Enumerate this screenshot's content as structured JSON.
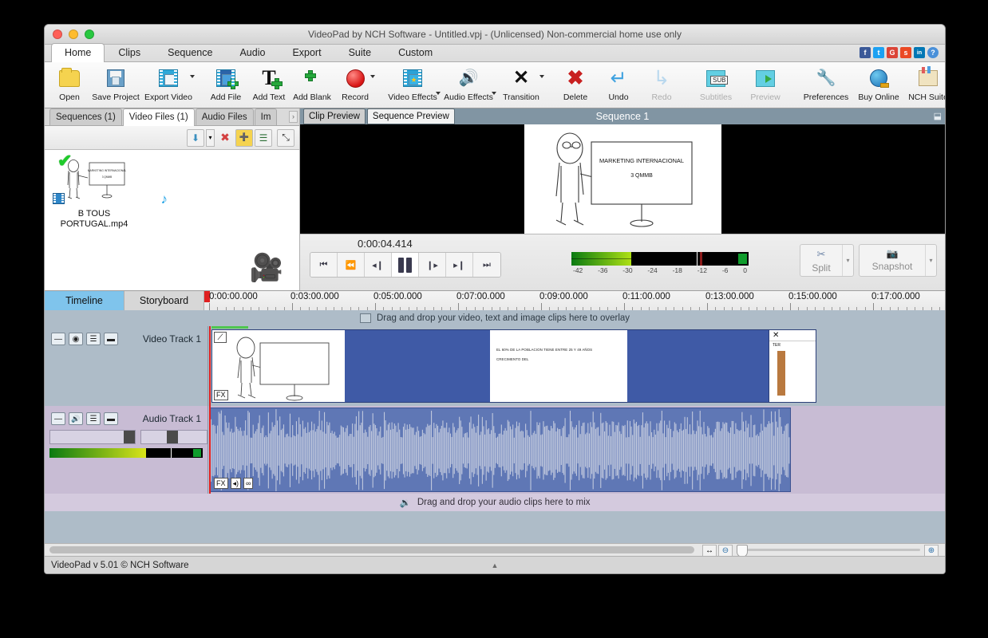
{
  "window": {
    "title": "VideoPad by NCH Software - Untitled.vpj - (Unlicensed) Non-commercial home use only"
  },
  "ribbon": {
    "tabs": [
      {
        "label": "Home",
        "active": true
      },
      {
        "label": "Clips",
        "active": false
      },
      {
        "label": "Sequence",
        "active": false
      },
      {
        "label": "Audio",
        "active": false
      },
      {
        "label": "Export",
        "active": false
      },
      {
        "label": "Suite",
        "active": false
      },
      {
        "label": "Custom",
        "active": false
      }
    ],
    "social": [
      {
        "name": "facebook-icon",
        "glyph": "f",
        "color": "#3b5998"
      },
      {
        "name": "twitter-icon",
        "glyph": "t",
        "color": "#1da1f2"
      },
      {
        "name": "google-plus-icon",
        "glyph": "G",
        "color": "#db4437"
      },
      {
        "name": "stumbleupon-icon",
        "glyph": "s",
        "color": "#eb4924"
      },
      {
        "name": "linkedin-icon",
        "glyph": "in",
        "color": "#0077b5"
      },
      {
        "name": "help-icon",
        "glyph": "?",
        "color": "#4a90d9"
      }
    ],
    "buttons": [
      {
        "label": "Open",
        "icon": "open-folder-icon",
        "dim": false
      },
      {
        "label": "Save Project",
        "icon": "save-project-icon",
        "dim": false
      },
      {
        "label": "Export Video",
        "icon": "export-video-icon",
        "dim": false
      },
      {
        "label": "Add File",
        "icon": "add-file-icon",
        "dim": false
      },
      {
        "label": "Add Text",
        "icon": "add-text-icon",
        "dim": false
      },
      {
        "label": "Add Blank",
        "icon": "add-blank-icon",
        "dim": false
      },
      {
        "label": "Record",
        "icon": "record-icon",
        "dim": false
      },
      {
        "label": "Video Effects",
        "icon": "video-effects-icon",
        "dim": false
      },
      {
        "label": "Audio Effects",
        "icon": "audio-effects-icon",
        "dim": false
      },
      {
        "label": "Transition",
        "icon": "transition-icon",
        "dim": false
      },
      {
        "label": "Delete",
        "icon": "delete-icon",
        "dim": false
      },
      {
        "label": "Undo",
        "icon": "undo-icon",
        "dim": false
      },
      {
        "label": "Redo",
        "icon": "redo-icon",
        "dim": true
      },
      {
        "label": "Subtitles",
        "icon": "subtitles-icon",
        "dim": true
      },
      {
        "label": "Preview",
        "icon": "preview-icon",
        "dim": true
      },
      {
        "label": "Preferences",
        "icon": "preferences-icon",
        "dim": false
      },
      {
        "label": "Buy Online",
        "icon": "buy-online-icon",
        "dim": false
      },
      {
        "label": "NCH Suite",
        "icon": "nch-suite-icon",
        "dim": false
      }
    ]
  },
  "bin": {
    "tabs": [
      {
        "label": "Sequences (1)",
        "active": false
      },
      {
        "label": "Video Files (1)",
        "active": true
      },
      {
        "label": "Audio Files",
        "active": false
      },
      {
        "label": "Im",
        "active": false
      }
    ],
    "more_label": "›",
    "tools": [
      {
        "name": "add-media-button",
        "glyph": "⬇"
      },
      {
        "name": "add-media-dropdown",
        "glyph": "▾"
      },
      {
        "name": "remove-media-button",
        "glyph": "✖"
      },
      {
        "name": "new-folder-button",
        "glyph": "➕"
      },
      {
        "name": "list-view-button",
        "glyph": "☰"
      },
      {
        "name": "detach-panel-button",
        "glyph": "⤡"
      }
    ],
    "item": {
      "filename": "B TOUS\nPORTUGAL.mp4",
      "filename_line1": "B TOUS",
      "filename_line2": "PORTUGAL.mp4",
      "selected_check": "✔"
    }
  },
  "preview": {
    "tabs": [
      {
        "label": "Clip Preview",
        "active": false
      },
      {
        "label": "Sequence Preview",
        "active": true
      }
    ],
    "title": "Sequence 1",
    "frame_text_line1": "MARKETING INTERNACIONAL",
    "frame_text_line2": "3 QMMB",
    "timecode": "0:00:04.414",
    "transport": [
      {
        "name": "jump-start-button",
        "glyph": "⏮"
      },
      {
        "name": "prev-frame-button",
        "glyph": "⏪"
      },
      {
        "name": "step-back-button",
        "glyph": "◂❙"
      },
      {
        "name": "pause-button",
        "glyph": "❙❙"
      },
      {
        "name": "step-forward-button",
        "glyph": "❙▸"
      },
      {
        "name": "next-frame-button",
        "glyph": "▸❙"
      },
      {
        "name": "jump-end-button",
        "glyph": "⏭"
      }
    ],
    "meter_scale": [
      "-42",
      "-36",
      "-30",
      "-24",
      "-18",
      "-12",
      "-6",
      "0"
    ],
    "split_label": "Split",
    "snapshot_label": "Snapshot"
  },
  "timeline": {
    "view_tabs": [
      {
        "label": "Timeline",
        "active": true
      },
      {
        "label": "Storyboard",
        "active": false
      }
    ],
    "ruler_labels": [
      "0:00:00.000",
      "0:03:00.000",
      "0:05:00.000",
      "0:07:00.000",
      "0:09:00.000",
      "0:11:00.000",
      "0:13:00.000",
      "0:15:00.000",
      "0:17:00.000"
    ],
    "overlay_hint": "Drag and drop your video, text and image clips here to overlay",
    "audio_hint": "Drag and drop your audio clips here to mix",
    "video_track": {
      "name": "Video Track 1",
      "controls": [
        {
          "name": "collapse-track-button",
          "glyph": "—"
        },
        {
          "name": "visibility-eye-icon",
          "glyph": "◉"
        },
        {
          "name": "track-group-icon",
          "glyph": "☰"
        },
        {
          "name": "lock-track-icon",
          "glyph": "▬"
        }
      ],
      "clip_text_line1": "EL 60% DE LA POBLACION TIENE ENTRE 25 Y 49 AÑOS",
      "clip_text_line2": "CRECIMENTO DEL",
      "fx_label": "FX",
      "end_clip_label": "TER"
    },
    "audio_track": {
      "name": "Audio Track 1",
      "controls": [
        {
          "name": "collapse-track-button",
          "glyph": "—"
        },
        {
          "name": "mute-speaker-icon",
          "glyph": "🔊"
        },
        {
          "name": "track-group-icon",
          "glyph": "☰"
        },
        {
          "name": "lock-track-icon",
          "glyph": "▬"
        }
      ],
      "clip_buttons": [
        {
          "name": "clip-fx-button",
          "label": "FX"
        },
        {
          "name": "clip-volume-button",
          "label": "◂)"
        },
        {
          "name": "clip-link-button",
          "label": "∞"
        }
      ]
    }
  },
  "bottom": {
    "zoom_fit_icon": "↔",
    "zoom_out_icon": "⊖",
    "zoom_in_icon": "⊕",
    "status_text": "VideoPad v 5.01 © NCH Software",
    "status_triangle": "▲"
  },
  "colors": {
    "accent": "#7fc4ec",
    "clip_blue": "#3f5aa6",
    "audio_clip": "#5f77b5",
    "video_track_bg": "#aebcc8",
    "audio_track_bg": "#c8bcd4",
    "playhead": "#e02020"
  }
}
